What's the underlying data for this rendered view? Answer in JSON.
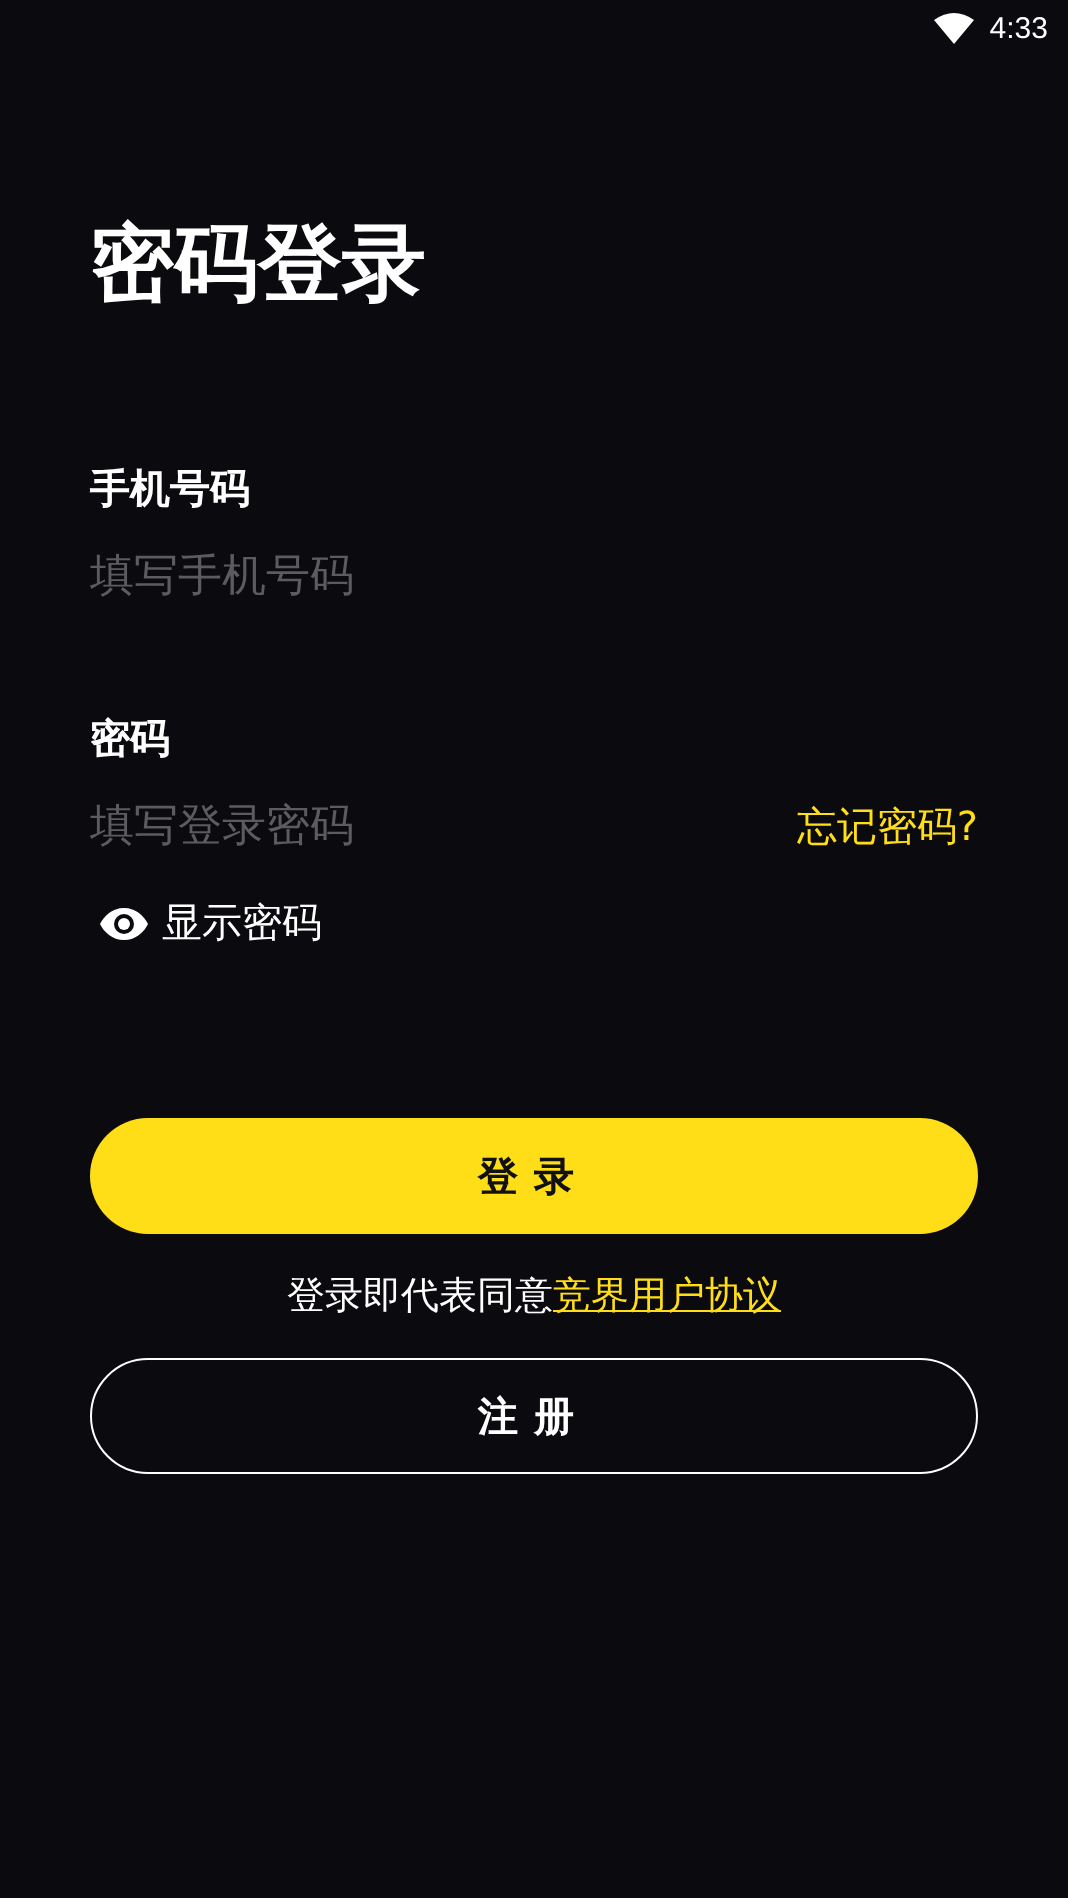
{
  "status_bar": {
    "time": "4:33"
  },
  "title": "密码登录",
  "phone": {
    "label": "手机号码",
    "placeholder": "填写手机号码"
  },
  "password": {
    "label": "密码",
    "placeholder": "填写登录密码",
    "forgot": "忘记密码?"
  },
  "show_password": {
    "label": "显示密码"
  },
  "login_button": "登录",
  "agreement": {
    "text": "登录即代表同意",
    "link": "竞界用户协议"
  },
  "register_button": "注册"
}
